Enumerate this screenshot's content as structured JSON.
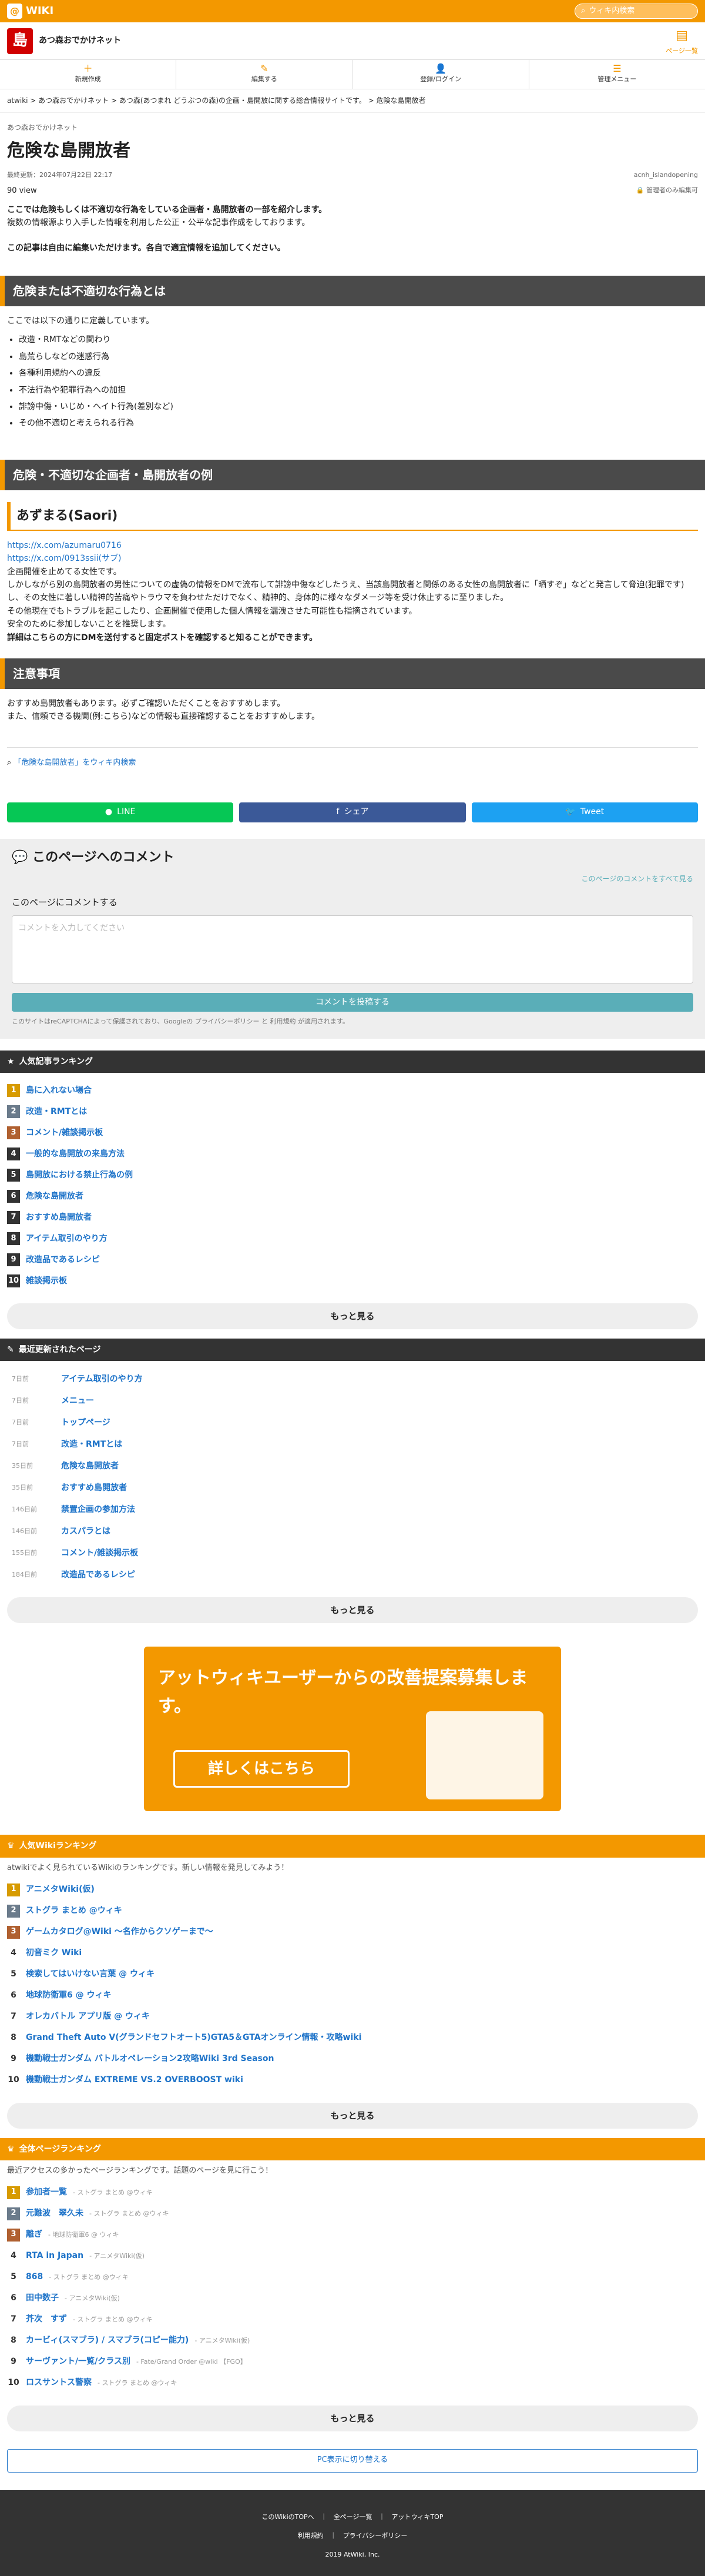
{
  "topbar": {
    "logo": "WIKI",
    "search_placeholder": "ウィキ内検索"
  },
  "site": {
    "icon": "島",
    "title": "あつ森おでかけネット",
    "page_btn": "ページ一覧"
  },
  "menu": [
    "新規作成",
    "編集する",
    "登録/ログイン",
    "管理メニュー"
  ],
  "breadcrumb": "atwiki > あつ森おでかけネット > あつ森(あつまれ どうぶつの森)の企画・島開放に関する総合情報サイトです。 > 危険な島開放者",
  "page": {
    "path": "あつ森おでかけネット",
    "title": "危険な島開放者",
    "updated": "最終更新：2024年07月22日 22:17",
    "author": "acnh_islandopening",
    "views": "90 view",
    "editor_only": "管理者のみ編集可",
    "intro1": "ここでは危険もしくは不適切な行為をしている企画者・島開放者の一部を紹介します。",
    "intro2": "複数の情報源より入手した情報を利用した公正・公平な記事作成をしております。",
    "intro3": "この記事は自由に編集いただけます。各自で適宜情報を追加してください。"
  },
  "section1": {
    "title": "危険または不適切な行為とは",
    "lead": "ここでは以下の通りに定義しています。",
    "items": [
      "改造・RMTなどの関わり",
      "島荒らしなどの迷惑行為",
      "各種利用規約への違反",
      "不法行為や犯罪行為への加担",
      "誹謗中傷・いじめ・ヘイト行為(差別など)",
      "その他不適切と考えられる行為"
    ]
  },
  "section2": {
    "title": "危険・不適切な企画者・島開放者の例"
  },
  "person": {
    "name": "あずまる(Saori)",
    "link1": "https://x.com/azumaru0716",
    "link2": "https://x.com/0913ssii(サブ)",
    "p1": "企画開催を止めてる女性です。",
    "p2": "しかしながら別の島開放者の男性についての虚偽の情報をDMで流布して誹謗中傷などしたうえ、当該島開放者と関係のある女性の島開放者に「晒すぞ」などと発言して脅迫(犯罪です)",
    "p3": "し、その女性に著しい精神的苦痛やトラウマを負わせただけでなく、精神的、身体的に様々なダメージ等を受け休止するに至りました。",
    "p4": "その他現在でもトラブルを起こしたり、企画開催で使用した個人情報を漏洩させた可能性も指摘されています。",
    "p5": "安全のために参加しないことを推奨します。",
    "p6": "詳細はこちらの方にDMを送付すると固定ポストを確認すると知ることができます。"
  },
  "notice": {
    "title": "注意事項",
    "p1": "おすすめ島開放者もあります。必ずご確認いただくことをおすすめします。",
    "p2": "また、信頼できる機関(例:こちら)などの情報も直接確認することをおすすめします。"
  },
  "wiki_search": "「危険な島開放者」をウィキ内検索",
  "share": {
    "line": "LINE",
    "facebook": "シェア",
    "twitter": "Tweet"
  },
  "comment": {
    "title": "このページへのコメント",
    "show_all": "このページのコメントをすべて見る",
    "label": "このページにコメントする",
    "placeholder": "コメントを入力してください",
    "button": "コメントを投稿する",
    "note": "このサイトはreCAPTCHAによって保護されており、Googleの プライバシーポリシー と 利用規約 が適用されます。"
  },
  "popular": {
    "title": "人気記事ランキング",
    "items": [
      "島に入れない場合",
      "改造・RMTとは",
      "コメント/雑談掲示板",
      "一般的な島開放の来島方法",
      "島開放における禁止行為の例",
      "危険な島開放者",
      "おすすめ島開放者",
      "アイテム取引のやり方",
      "改造品であるレシピ",
      "雑談掲示板"
    ],
    "more": "もっと見る"
  },
  "recent": {
    "title": "最近更新されたページ",
    "items": [
      {
        "ago": "7日前",
        "name": "アイテム取引のやり方"
      },
      {
        "ago": "7日前",
        "name": "メニュー"
      },
      {
        "ago": "7日前",
        "name": "トップページ"
      },
      {
        "ago": "7日前",
        "name": "改造・RMTとは"
      },
      {
        "ago": "35日前",
        "name": "危険な島開放者"
      },
      {
        "ago": "35日前",
        "name": "おすすめ島開放者"
      },
      {
        "ago": "146日前",
        "name": "禁置企画の参加方法"
      },
      {
        "ago": "146日前",
        "name": "カスパラとは"
      },
      {
        "ago": "155日前",
        "name": "コメント/雑談掲示板"
      },
      {
        "ago": "184日前",
        "name": "改造品であるレシピ"
      }
    ],
    "more": "もっと見る"
  },
  "banner": {
    "t1": "アットウィキユーザーからの改善提案募集します。",
    "btn": "詳しくはこちら"
  },
  "wikirank": {
    "title": "人気Wikiランキング",
    "lead": "atwikiでよく見られているWikiのランキングです。新しい情報を発見してみよう！",
    "items": [
      "アニメタWiki(仮)",
      "ストグラ まとめ @ウィキ",
      "ゲームカタログ@Wiki ～名作からクソゲーまで～",
      "初音ミク Wiki",
      "検索してはいけない言葉 @ ウィキ",
      "地球防衛軍6 @ ウィキ",
      "オレカバトル アプリ版 @ ウィキ",
      "Grand Theft Auto V(グランドセフトオート5)GTA5＆GTAオンライン情報・攻略wiki",
      "機動戦士ガンダム バトルオペレーション2攻略Wiki 3rd Season",
      "機動戦士ガンダム EXTREME VS.2 OVERBOOST wiki"
    ],
    "more": "もっと見る"
  },
  "allrank": {
    "title": "全体ページランキング",
    "lead": "最近アクセスの多かったページランキングです。話題のページを見に行こう！",
    "items": [
      {
        "name": "参加者一覧",
        "sub": "- ストグラ まとめ @ウィキ"
      },
      {
        "name": "元難波　翠久未",
        "sub": "- ストグラ まとめ @ウィキ"
      },
      {
        "name": "離ぎ",
        "sub": "- 地球防衛軍6 @ ウィキ"
      },
      {
        "name": "RTA in Japan",
        "sub": "- アニメタWiki(仮)"
      },
      {
        "name": "868",
        "sub": "- ストグラ まとめ @ウィキ"
      },
      {
        "name": "田中数子",
        "sub": "- アニメタWiki(仮)"
      },
      {
        "name": "芥次　すず",
        "sub": "- ストグラ まとめ @ウィキ"
      },
      {
        "name": "カービィ(スマブラ) / スマブラ(コピー能力)",
        "sub": "- アニメタWiki(仮)"
      },
      {
        "name": "サーヴァント/一覧/クラス別",
        "sub": "- Fate/Grand Order @wiki 【FGO】"
      },
      {
        "name": "ロスサントス警察",
        "sub": "- ストグラ まとめ @ウィキ"
      }
    ],
    "more": "もっと見る"
  },
  "pc": "PC表示に切り替える",
  "footer": {
    "l1": "このWikiのTOPへ　｜　全ページ一覧　｜　アットウィキTOP",
    "l2": "利用規約　｜　プライバシーポリシー",
    "copy": "2019 AtWiki, Inc."
  }
}
